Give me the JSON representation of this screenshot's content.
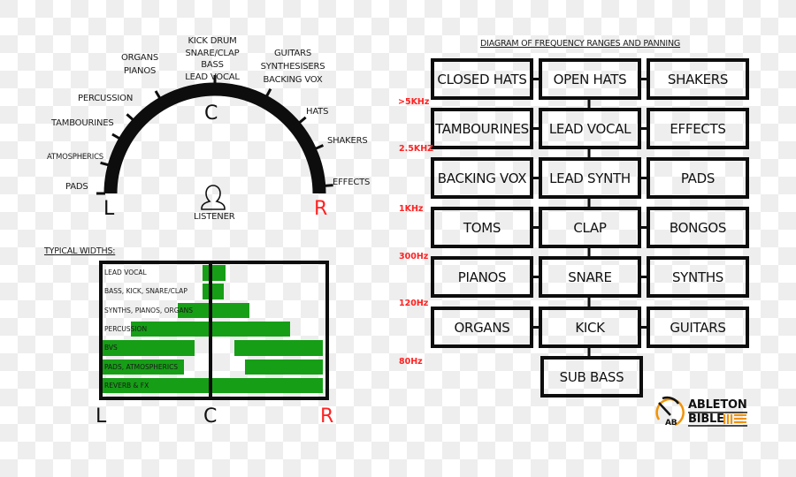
{
  "panning_arc": {
    "center_letter": "C",
    "left_letter": "L",
    "right_letter": "R",
    "listener_label": "LISTENER",
    "listener_icon": "person-outline-icon",
    "positions": [
      {
        "label": "PADS"
      },
      {
        "label": "ATMOSPHERICS"
      },
      {
        "label": "TAMBOURINES"
      },
      {
        "label": "PERCUSSION"
      },
      {
        "label": "ORGANS\nPIANOS"
      },
      {
        "label": "KICK DRUM\nSNARE/CLAP\nBASS\nLEAD VOCAL"
      },
      {
        "label": "GUITARS\nSYNTHESISERS\nBACKING VOX"
      },
      {
        "label": "HATS"
      },
      {
        "label": "SHAKERS"
      },
      {
        "label": "EFFECTS"
      }
    ]
  },
  "widths_chart": {
    "title": "TYPICAL WIDTHS:",
    "axis": {
      "left": "L",
      "center": "C",
      "right": "R"
    },
    "colors": {
      "bar": "#169e16",
      "right_label": "#ff2222"
    },
    "note": "Pan range -1 (L) to +1 (R); each row lists covered segments",
    "rows": [
      {
        "label": "LEAD VOCAL",
        "segments": [
          [
            -0.07,
            0.13
          ]
        ]
      },
      {
        "label": "BASS, KICK, SNARE/CLAP",
        "segments": [
          [
            -0.07,
            0.12
          ]
        ]
      },
      {
        "label": "SYNTHS, PIANOS, ORGANS",
        "segments": [
          [
            -0.29,
            0.35
          ]
        ]
      },
      {
        "label": "PERCUSSION",
        "segments": [
          [
            -0.71,
            0.71
          ]
        ]
      },
      {
        "label": "BVS",
        "segments": [
          [
            -1.0,
            -0.14
          ],
          [
            0.21,
            1.0
          ]
        ]
      },
      {
        "label": "PADS, ATMOSPHERICS",
        "segments": [
          [
            -1.0,
            -0.24
          ],
          [
            0.31,
            1.0
          ]
        ]
      },
      {
        "label": "REVERB & FX",
        "segments": [
          [
            -1.0,
            1.0
          ]
        ]
      }
    ]
  },
  "frequency_diagram": {
    "title": "DIAGRAM OF FREQUENCY RANGES AND PANNING",
    "freq_labels": [
      ">5KHz",
      "2.5KHZ",
      "1KHz",
      "300Hz",
      "120Hz",
      "80Hz"
    ],
    "rows": [
      [
        "CLOSED HATS",
        "OPEN HATS",
        "SHAKERS"
      ],
      [
        "TAMBOURINES",
        "LEAD VOCAL",
        "EFFECTS"
      ],
      [
        "BACKING VOX",
        "LEAD SYNTH",
        "PADS"
      ],
      [
        "TOMS",
        "CLAP",
        "BONGOS"
      ],
      [
        "PIANOS",
        "SNARE",
        "SYNTHS"
      ],
      [
        "ORGANS",
        "KICK",
        "GUITARS"
      ]
    ],
    "bottom": "SUB BASS"
  },
  "logo": {
    "line1": "ABLETON",
    "line2": "BIBLE",
    "mark": "AB",
    "accent": "#f39200"
  }
}
